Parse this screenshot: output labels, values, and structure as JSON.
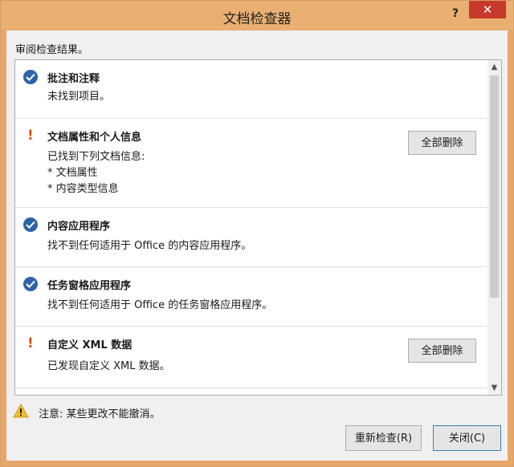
{
  "window": {
    "title": "文档检查器",
    "help_label": "?",
    "close_label": "✕"
  },
  "header": "审阅检查结果。",
  "items": [
    {
      "status": "ok",
      "title": "批注和注释",
      "lines": [
        "未找到项目。"
      ],
      "button": null
    },
    {
      "status": "warn",
      "title": "文档属性和个人信息",
      "lines": [
        "已找到下列文档信息:",
        "* 文档属性",
        "* 内容类型信息"
      ],
      "button": "全部删除"
    },
    {
      "status": "ok",
      "title": "内容应用程序",
      "lines": [
        "找不到任何适用于 Office 的内容应用程序。"
      ],
      "button": null
    },
    {
      "status": "ok",
      "title": "任务窗格应用程序",
      "lines": [
        "找不到任何适用于 Office 的任务窗格应用程序。"
      ],
      "button": null
    },
    {
      "status": "warn",
      "title": "自定义 XML 数据",
      "lines": [
        "已发现自定义 XML 数据。"
      ],
      "button": "全部删除"
    }
  ],
  "note": "注意: 某些更改不能撤消。",
  "buttons": {
    "reinspect": "重新检查(R)",
    "close": "关闭(C)"
  },
  "colors": {
    "accent": "#2e63a8",
    "warn": "#d9541c",
    "titlebar": "#eab071",
    "close": "#c7392b"
  }
}
